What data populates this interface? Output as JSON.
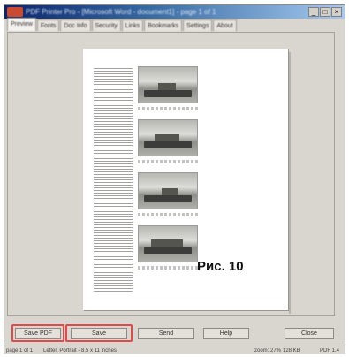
{
  "window": {
    "title": "PDF Printer Pro - [Microsoft Word - document1] - page 1 of 1",
    "controls": [
      "_",
      "□",
      "×"
    ]
  },
  "tabs": [
    "Preview",
    "Fonts",
    "Doc Info",
    "Security",
    "Links",
    "Bookmarks",
    "Settings",
    "About"
  ],
  "figure_label": "Рис. 10",
  "buttons": {
    "save_pdf": "Save PDF",
    "save": "Save",
    "send": "Send",
    "help": "Help",
    "close": "Close"
  },
  "status": {
    "page": "page 1 of 1",
    "paper": "Letter, Portrait - 8.5 x 11 inches",
    "zoom": "zoom: 27%",
    "size": "128 KB",
    "pdf": "PDF 1.4"
  }
}
